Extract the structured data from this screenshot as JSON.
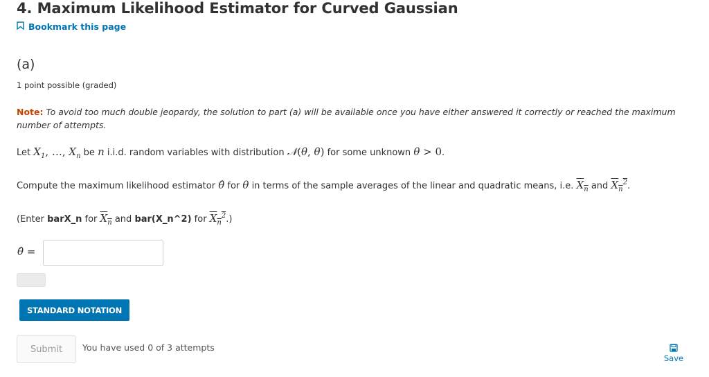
{
  "header": {
    "title": "4. Maximum Likelihood Estimator for Curved Gaussian",
    "bookmark_label": "Bookmark this page"
  },
  "problem": {
    "part": "(a)",
    "points": "1 point possible (graded)",
    "note_label": "Note:",
    "note_text": "To avoid too much double jeopardy, the solution to part (a) will be available once you have either answered it correctly or reached the maximum number of attempts.",
    "let_prefix": "Let",
    "let_mid": "be",
    "let_mid2": "i.i.d. random variables with distribution",
    "let_suffix": "for some unknown",
    "compute_prefix": "Compute the maximum likelihood estimator",
    "compute_mid": "for",
    "compute_mid2": "in terms of the sample averages of the linear and quadratic means, i.e.",
    "compute_and": "and",
    "enter_open": "(Enter",
    "enter_code1": "barX_n",
    "enter_for1": "for",
    "enter_and": "and",
    "enter_code2": "bar(X_n^2)",
    "enter_for2": "for",
    "enter_close": ".)"
  },
  "answer": {
    "value": "",
    "placeholder": ""
  },
  "buttons": {
    "standard_notation": "STANDARD NOTATION",
    "submit": "Submit",
    "save": "Save"
  },
  "status": {
    "attempts": "You have used 0 of 3 attempts"
  },
  "colors": {
    "accent": "#0075b4",
    "note_label": "#c74400"
  }
}
